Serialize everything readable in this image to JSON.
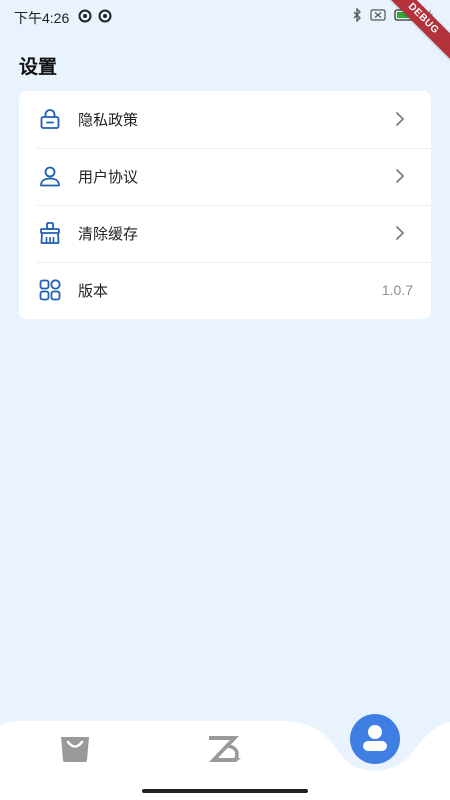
{
  "status_bar": {
    "time": "下午4:26",
    "left_icons": [
      "notification-icon",
      "notification-icon"
    ],
    "right_icons": [
      "bluetooth-icon",
      "sim-icon",
      "battery-icon",
      "charging-icon"
    ]
  },
  "debug_banner": "DEBUG",
  "page": {
    "title": "设置"
  },
  "settings": {
    "items": [
      {
        "icon": "lock-icon",
        "label": "隐私政策",
        "has_chevron": true
      },
      {
        "icon": "user-icon",
        "label": "用户协议",
        "has_chevron": true
      },
      {
        "icon": "broom-icon",
        "label": "清除缓存",
        "has_chevron": true
      },
      {
        "icon": "grid-icon",
        "label": "版本",
        "value": "1.0.7"
      }
    ]
  },
  "bottom_nav": {
    "tabs": [
      {
        "icon": "shopping-bag-icon",
        "active": false
      },
      {
        "icon": "logo-z-icon",
        "active": false
      },
      {
        "icon": "profile-icon",
        "active": true
      }
    ]
  },
  "colors": {
    "background": "#e9f3fd",
    "accent": "#3f7ee3",
    "icon_blue": "#1f5fb8",
    "chevron": "#7a7f86",
    "debug": "#b4323a"
  }
}
